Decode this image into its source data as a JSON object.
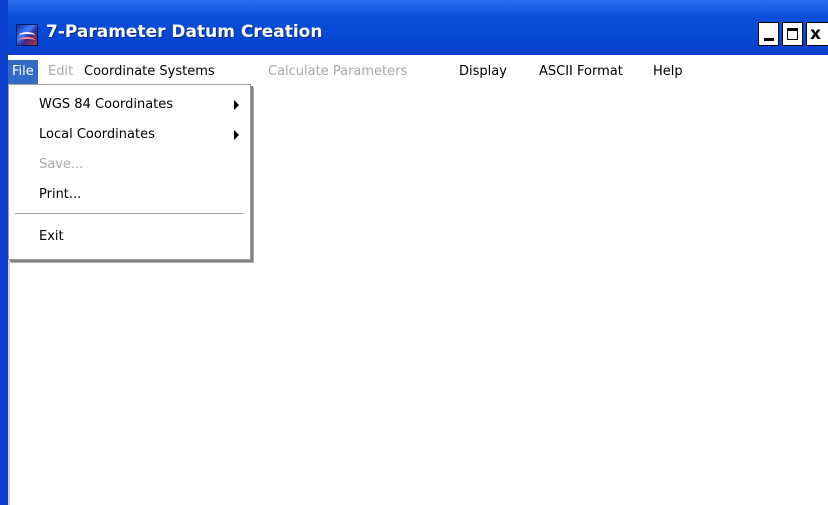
{
  "window": {
    "title": "7-Parameter Datum Creation",
    "icon": "app-globe-icon",
    "controls": {
      "minimize": "minimize-icon",
      "maximize": "maximize-icon",
      "close": "close-icon"
    },
    "close_glyph": "x"
  },
  "menubar": {
    "items": [
      {
        "label": "File",
        "state": "active"
      },
      {
        "label": "Edit",
        "state": "disabled"
      },
      {
        "label": "Coordinate Systems",
        "state": "enabled"
      },
      {
        "label": "Calculate Parameters",
        "state": "disabled"
      },
      {
        "label": "Display",
        "state": "enabled"
      },
      {
        "label": "ASCII Format",
        "state": "enabled"
      },
      {
        "label": "Help",
        "state": "enabled"
      }
    ]
  },
  "file_menu": {
    "items": [
      {
        "label": "WGS 84 Coordinates",
        "submenu": true,
        "state": "enabled"
      },
      {
        "label": "Local Coordinates",
        "submenu": true,
        "state": "enabled"
      },
      {
        "label": "Save...",
        "submenu": false,
        "state": "disabled"
      },
      {
        "label": "Print...",
        "submenu": false,
        "state": "enabled"
      },
      {
        "label": "Exit",
        "submenu": false,
        "state": "enabled"
      }
    ],
    "icons": {
      "submenu": "chevron-right-icon"
    }
  },
  "colors": {
    "titlebar": "#0a4fd8",
    "menu_highlight": "#316ac5",
    "disabled_text": "#a7a7a7"
  }
}
